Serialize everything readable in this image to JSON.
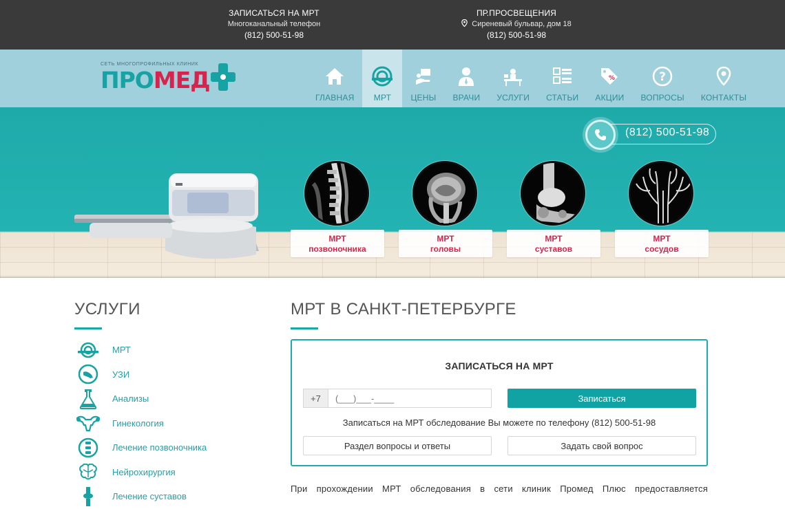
{
  "topbar": {
    "col1": {
      "title": "ЗАПИСАТЬСЯ НА МРТ",
      "subtitle": "Многоканальный телефон",
      "phone": "(812) 500-51-98"
    },
    "col2": {
      "title": "ПР.ПРОСВЕЩЕНИЯ",
      "address": "Сиреневый бульвар, дом 18",
      "phone": "(812) 500-51-98"
    }
  },
  "logo": {
    "tagline": "СЕТЬ МНОГОПРОФИЛЬНЫХ КЛИНИК",
    "part1": "ПРО",
    "part2": "МЕД"
  },
  "nav": {
    "items": [
      {
        "label": "ГЛАВНАЯ",
        "icon": "home-icon"
      },
      {
        "label": "МРТ",
        "icon": "mri-icon",
        "active": true
      },
      {
        "label": "ЦЕНЫ",
        "icon": "price-icon"
      },
      {
        "label": "ВРАЧИ",
        "icon": "doctor-icon"
      },
      {
        "label": "УСЛУГИ",
        "icon": "services-icon"
      },
      {
        "label": "СТАТЬИ",
        "icon": "articles-icon"
      },
      {
        "label": "АКЦИИ",
        "icon": "tag-icon"
      },
      {
        "label": "ВОПРОСЫ",
        "icon": "question-icon"
      },
      {
        "label": "КОНТАКТЫ",
        "icon": "location-icon"
      }
    ]
  },
  "hero": {
    "phone": "(812) 500-51-98",
    "scans": [
      {
        "line1": "МРТ",
        "line2": "позвоночника"
      },
      {
        "line1": "МРТ",
        "line2": "головы"
      },
      {
        "line1": "МРТ",
        "line2": "суставов"
      },
      {
        "line1": "МРТ",
        "line2": "сосудов"
      }
    ]
  },
  "sidebar": {
    "title": "УСЛУГИ",
    "items": [
      {
        "label": "МРТ",
        "icon": "mri-icon"
      },
      {
        "label": "УЗИ",
        "icon": "ultrasound-icon"
      },
      {
        "label": "Анализы",
        "icon": "flask-icon"
      },
      {
        "label": "Гинекология",
        "icon": "uterus-icon"
      },
      {
        "label": "Лечение позвоночника",
        "icon": "spine-icon"
      },
      {
        "label": "Нейрохирургия",
        "icon": "brain-icon"
      },
      {
        "label": "Лечение суставов",
        "icon": "joint-icon"
      }
    ]
  },
  "main": {
    "title": "МРТ В САНКТ-ПЕТЕРБУРГЕ",
    "form": {
      "title": "ЗАПИСАТЬСЯ НА МРТ",
      "prefix": "+7",
      "placeholder": "(___)___-____",
      "submit": "Записаться",
      "note": "Записаться на МРТ обследование Вы можете по телефону (812) 500-51-98",
      "faq_button": "Раздел вопросы и ответы",
      "ask_button": "Задать свой вопрос"
    },
    "body_text": "При прохождении МРТ обследования в сети клиник Промед Плюс предоставляется"
  },
  "colors": {
    "teal": "#11a2a3",
    "red": "#d6244d",
    "dark": "#3a3a3a",
    "nav_bg": "#9fd0dc"
  }
}
